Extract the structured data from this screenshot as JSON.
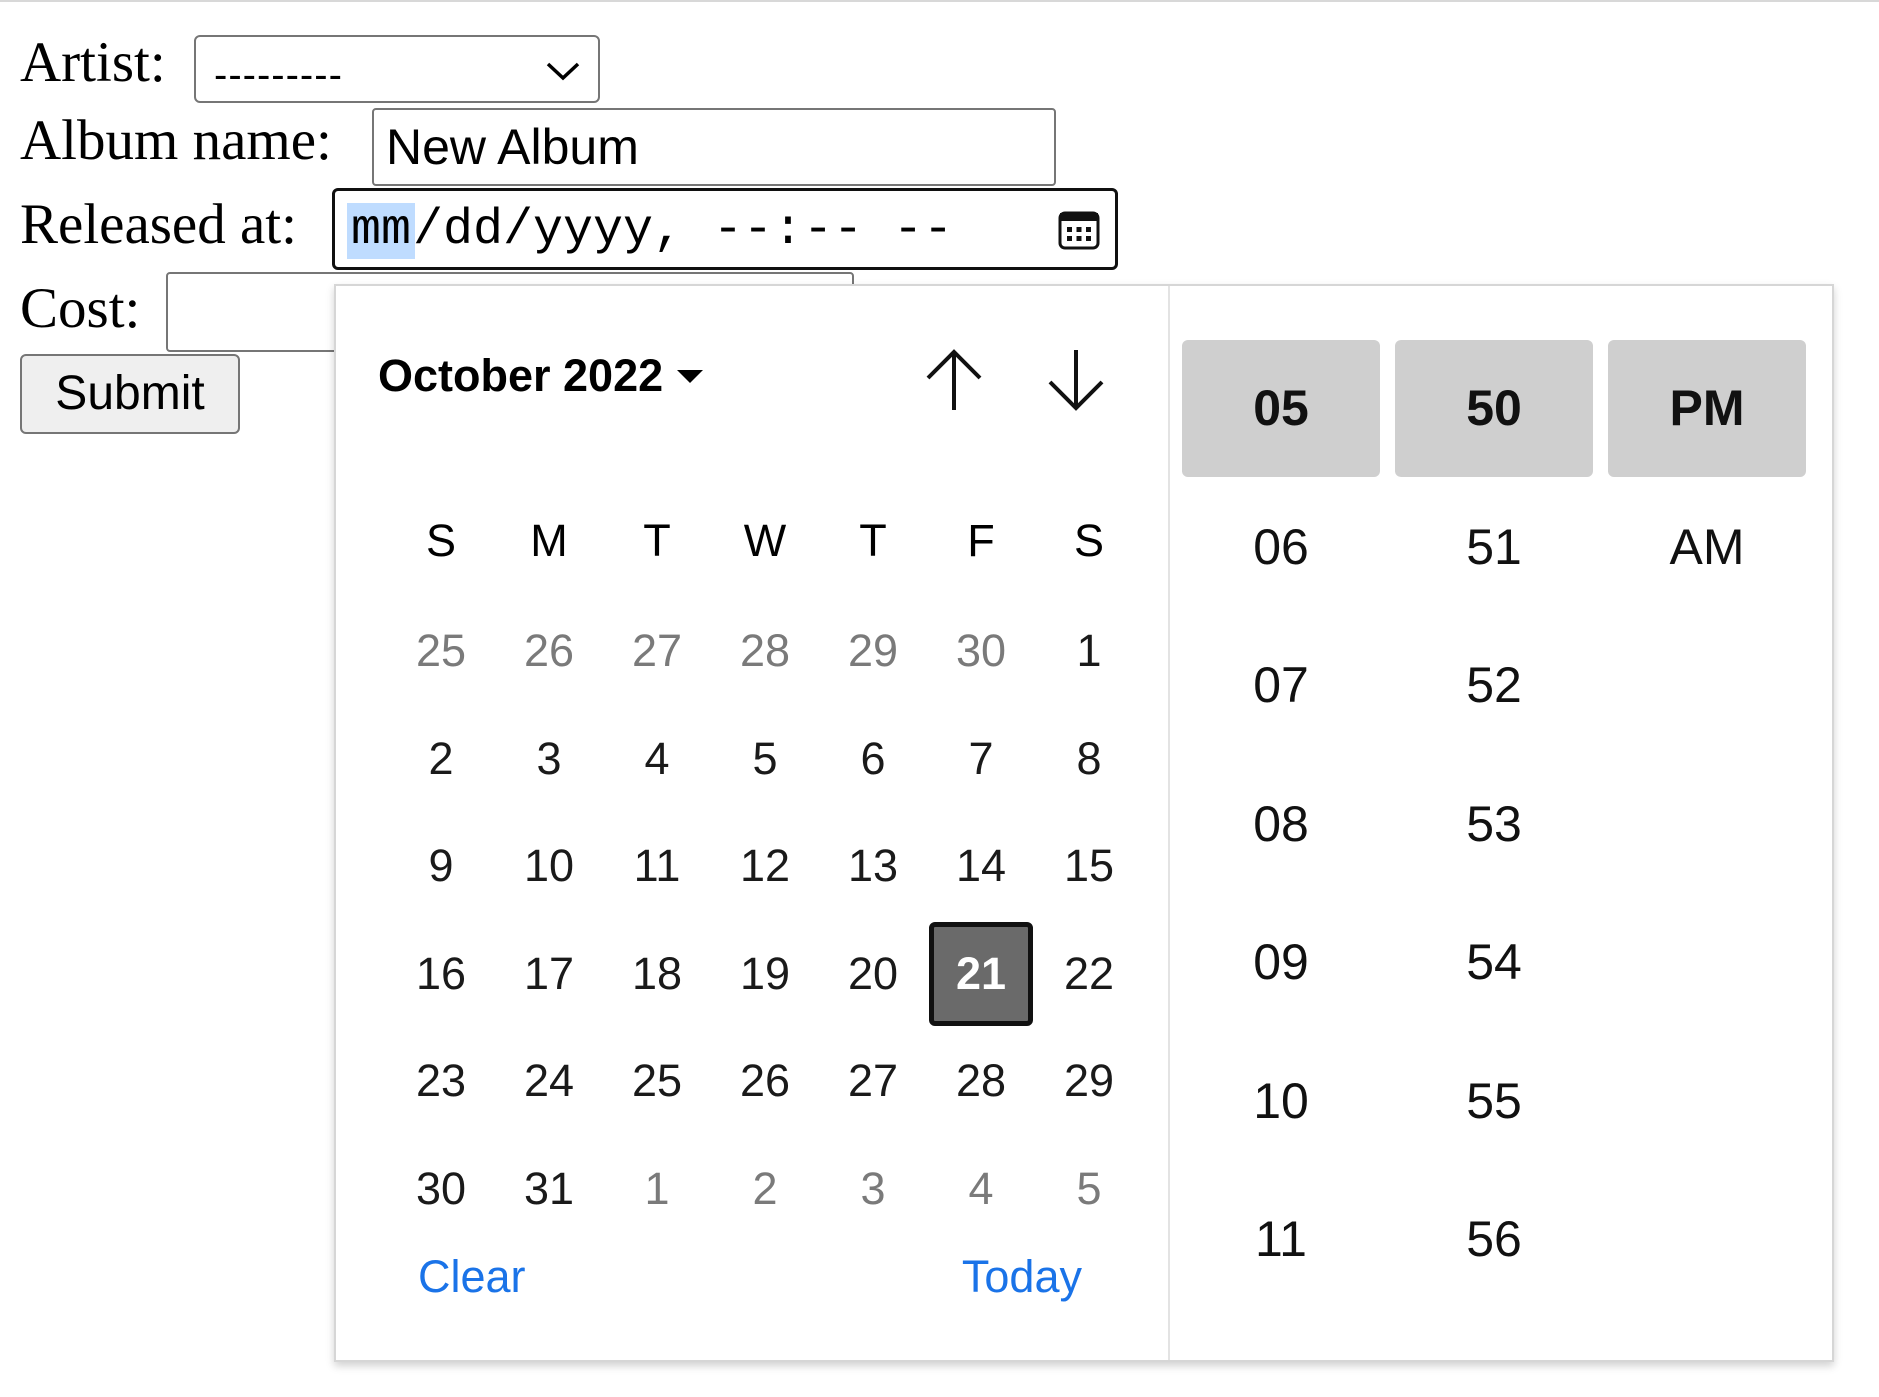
{
  "form": {
    "artist_label": "Artist:",
    "artist_value": "---------",
    "album_label": "Album name:",
    "album_value": "New Album",
    "released_label": "Released at:",
    "released_mm": "mm",
    "released_rest": "/dd/yyyy, --:-- --",
    "cost_label": "Cost:",
    "cost_value": "",
    "submit_label": "Submit"
  },
  "picker": {
    "month_label": "October 2022",
    "weekdays": [
      "S",
      "M",
      "T",
      "W",
      "T",
      "F",
      "S"
    ],
    "weeks": [
      [
        {
          "d": "25",
          "o": true
        },
        {
          "d": "26",
          "o": true
        },
        {
          "d": "27",
          "o": true
        },
        {
          "d": "28",
          "o": true
        },
        {
          "d": "29",
          "o": true
        },
        {
          "d": "30",
          "o": true
        },
        {
          "d": "1"
        }
      ],
      [
        {
          "d": "2"
        },
        {
          "d": "3"
        },
        {
          "d": "4"
        },
        {
          "d": "5"
        },
        {
          "d": "6"
        },
        {
          "d": "7"
        },
        {
          "d": "8"
        }
      ],
      [
        {
          "d": "9"
        },
        {
          "d": "10"
        },
        {
          "d": "11"
        },
        {
          "d": "12"
        },
        {
          "d": "13"
        },
        {
          "d": "14"
        },
        {
          "d": "15"
        }
      ],
      [
        {
          "d": "16"
        },
        {
          "d": "17"
        },
        {
          "d": "18"
        },
        {
          "d": "19"
        },
        {
          "d": "20"
        },
        {
          "d": "21",
          "s": true
        },
        {
          "d": "22"
        }
      ],
      [
        {
          "d": "23"
        },
        {
          "d": "24"
        },
        {
          "d": "25"
        },
        {
          "d": "26"
        },
        {
          "d": "27"
        },
        {
          "d": "28"
        },
        {
          "d": "29"
        }
      ],
      [
        {
          "d": "30"
        },
        {
          "d": "31"
        },
        {
          "d": "1",
          "o": true
        },
        {
          "d": "2",
          "o": true
        },
        {
          "d": "3",
          "o": true
        },
        {
          "d": "4",
          "o": true
        },
        {
          "d": "5",
          "o": true
        }
      ]
    ],
    "clear_label": "Clear",
    "today_label": "Today",
    "hours": [
      "05",
      "06",
      "07",
      "08",
      "09",
      "10",
      "11"
    ],
    "minutes": [
      "50",
      "51",
      "52",
      "53",
      "54",
      "55",
      "56"
    ],
    "meridiem": [
      "PM",
      "AM"
    ],
    "selected_hour": "05",
    "selected_minute": "50",
    "selected_meridiem": "PM"
  },
  "colors": {
    "link": "#1a73e8",
    "selected_day_bg": "#6a6a6a",
    "selected_time_bg": "#cfcfcf",
    "field_highlight": "#bfdcff"
  },
  "icons": {
    "select_arrow": "chevron-down-icon",
    "calendar": "calendar-icon",
    "prev_month": "arrow-up-icon",
    "next_month": "arrow-down-icon",
    "month_menu": "caret-down-icon"
  }
}
